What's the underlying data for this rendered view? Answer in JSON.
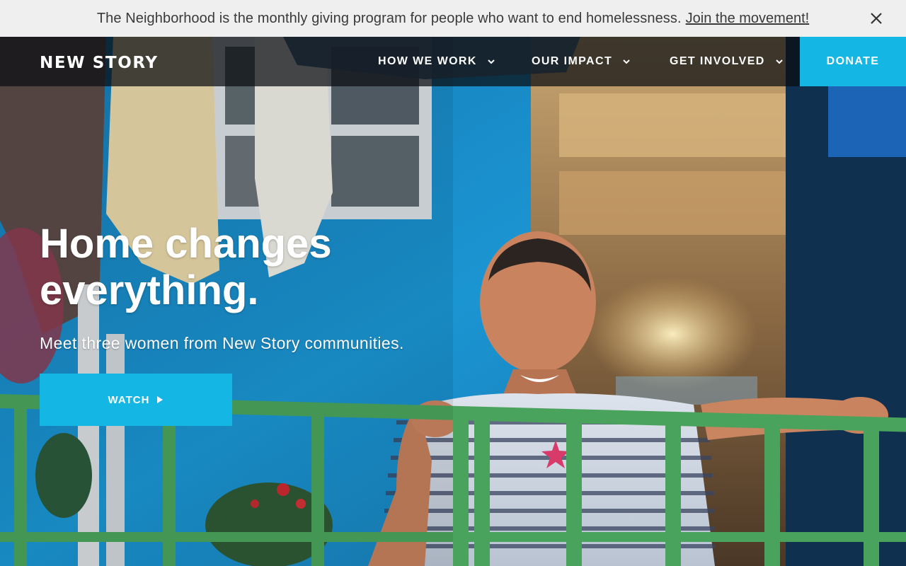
{
  "announcement": {
    "text": "The Neighborhood is the monthly giving program for people who want to end homelessness.",
    "link_label": "Join the movement!",
    "close_icon": "close-icon"
  },
  "nav": {
    "logo": "NEW STORY",
    "items": [
      {
        "label": "HOW WE WORK",
        "icon": "chevron-down-icon"
      },
      {
        "label": "OUR IMPACT",
        "icon": "chevron-down-icon"
      },
      {
        "label": "GET INVOLVED",
        "icon": "chevron-down-icon"
      }
    ],
    "donate_label": "DONATE"
  },
  "hero": {
    "headline": "Home changes everything.",
    "subhead": "Meet three women from New Story communities.",
    "cta_label": "WATCH",
    "cta_icon": "play-icon"
  },
  "colors": {
    "accent": "#14b6e3",
    "announcement_bg": "#efefef",
    "wall_blue": "#1e8fc9",
    "railing_green": "#4aa35c"
  }
}
